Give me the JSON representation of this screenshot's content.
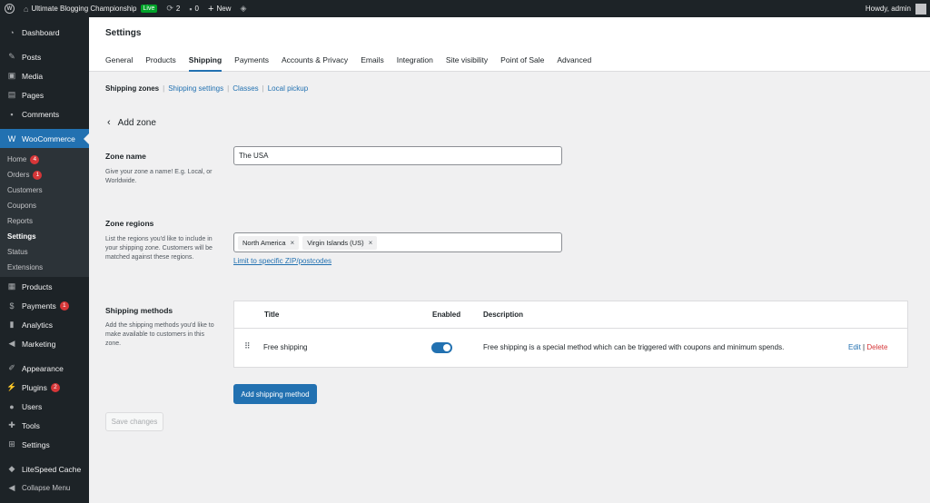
{
  "adminbar": {
    "site_name": "Ultimate Blogging Championship",
    "live_badge": "Live",
    "updates_count": "2",
    "comments_count": "0",
    "new_label": "New",
    "howdy": "Howdy, admin"
  },
  "sidebar": {
    "dashboard": "Dashboard",
    "posts": "Posts",
    "media": "Media",
    "pages": "Pages",
    "comments": "Comments",
    "woocommerce": "WooCommerce",
    "sub": {
      "home": "Home",
      "home_count": "4",
      "orders": "Orders",
      "orders_count": "1",
      "customers": "Customers",
      "coupons": "Coupons",
      "reports": "Reports",
      "settings": "Settings",
      "status": "Status",
      "extensions": "Extensions"
    },
    "products": "Products",
    "payments": "Payments",
    "payments_count": "1",
    "analytics": "Analytics",
    "marketing": "Marketing",
    "appearance": "Appearance",
    "plugins": "Plugins",
    "plugins_count": "2",
    "users": "Users",
    "tools": "Tools",
    "settings": "Settings",
    "litespeed": "LiteSpeed Cache",
    "collapse": "Collapse Menu"
  },
  "header": {
    "title": "Settings",
    "tabs": [
      "General",
      "Products",
      "Shipping",
      "Payments",
      "Accounts & Privacy",
      "Emails",
      "Integration",
      "Site visibility",
      "Point of Sale",
      "Advanced"
    ]
  },
  "subnav": {
    "zones": "Shipping zones",
    "settings": "Shipping settings",
    "classes": "Classes",
    "pickup": "Local pickup",
    "separator": "|"
  },
  "page_title": "Add zone",
  "zone_name": {
    "label": "Zone name",
    "desc": "Give your zone a name! E.g. Local, or Worldwide.",
    "value": "The USA"
  },
  "zone_regions": {
    "label": "Zone regions",
    "desc": "List the regions you'd like to include in your shipping zone. Customers will be matched against these regions.",
    "chips": [
      "North America",
      "Virgin Islands (US)"
    ],
    "remove_glyph": "×",
    "zip_link": "Limit to specific ZIP/postcodes"
  },
  "shipping_methods": {
    "label": "Shipping methods",
    "desc": "Add the shipping methods you'd like to make available to customers in this zone.",
    "col_title": "Title",
    "col_enabled": "Enabled",
    "col_desc": "Description",
    "row": {
      "title": "Free shipping",
      "enabled": true,
      "description": "Free shipping is a special method which can be triggered with coupons and minimum spends.",
      "edit": "Edit",
      "sep": "|",
      "delete": "Delete"
    },
    "add_button": "Add shipping method"
  },
  "save_button": "Save changes",
  "colors": {
    "accent": "#2271b1",
    "adminbar": "#1d2327",
    "danger": "#d63638",
    "live": "#00a32a"
  }
}
